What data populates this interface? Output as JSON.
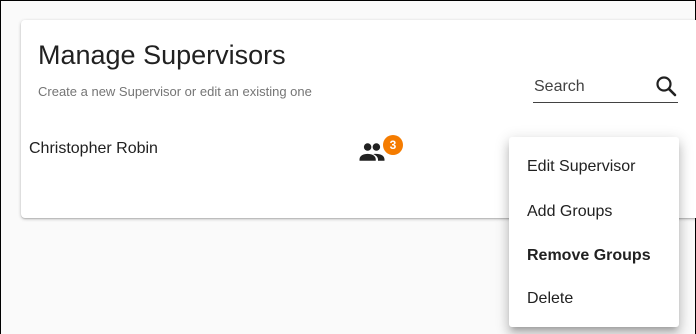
{
  "header": {
    "title": "Manage Supervisors",
    "subtitle": "Create a new Supervisor or edit an existing one"
  },
  "search": {
    "placeholder": "Search",
    "icon": "search-icon"
  },
  "supervisors": [
    {
      "name": "Christopher Robin",
      "groups_icon": "people-icon",
      "group_count": "3"
    }
  ],
  "context_menu": {
    "items": [
      {
        "label": "Edit Supervisor",
        "emphasized": false
      },
      {
        "label": "Add Groups",
        "emphasized": false
      },
      {
        "label": "Remove Groups",
        "emphasized": true
      },
      {
        "label": "Delete",
        "emphasized": false
      }
    ]
  },
  "colors": {
    "badge": "#f57c00",
    "title_text": "#212121",
    "subtitle_text": "#757575"
  }
}
